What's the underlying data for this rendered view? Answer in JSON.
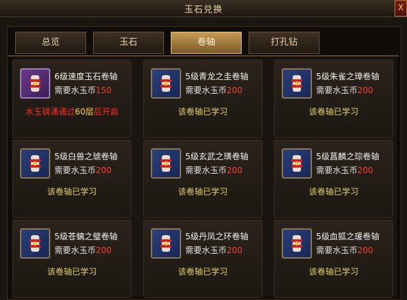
{
  "window": {
    "title": "玉石兑换",
    "close_label": "X"
  },
  "tabs": [
    "总览",
    "玉石",
    "卷轴",
    "打孔钻"
  ],
  "active_tab_index": 2,
  "currency": "需要水玉币",
  "scrolls": [
    {
      "name": "6级速度玉石卷轴",
      "cost": "150",
      "icon": "scroll-icon",
      "rarity": "purple",
      "status": "locked",
      "status_pre": "水玉镜涌通过",
      "status_mid": "60层",
      "status_post": "后开启"
    },
    {
      "name": "5级青龙之圭卷轴",
      "cost": "200",
      "icon": "scroll-icon",
      "rarity": "blue",
      "status": "learned",
      "status_text": "该卷轴已学习"
    },
    {
      "name": "5级朱雀之璋卷轴",
      "cost": "200",
      "icon": "scroll-icon",
      "rarity": "blue",
      "status": "learned",
      "status_text": "该卷轴已学习"
    },
    {
      "name": "5级白兽之琥卷轴",
      "cost": "200",
      "icon": "scroll-icon",
      "rarity": "blue",
      "status": "learned",
      "status_text": "该卷轴已学习"
    },
    {
      "name": "5级玄武之璜卷轴",
      "cost": "200",
      "icon": "scroll-icon",
      "rarity": "blue",
      "status": "learned",
      "status_text": "该卷轴已学习"
    },
    {
      "name": "5级菖麟之琮卷轴",
      "cost": "200",
      "icon": "scroll-icon",
      "rarity": "blue",
      "status": "learned",
      "status_text": "该卷轴已学习"
    },
    {
      "name": "5级苍螭之璧卷轴",
      "cost": "200",
      "icon": "scroll-icon",
      "rarity": "blue",
      "status": "learned",
      "status_text": "该卷轴已学习"
    },
    {
      "name": "5级丹凤之环卷轴",
      "cost": "200",
      "icon": "scroll-icon",
      "rarity": "blue",
      "status": "learned",
      "status_text": "该卷轴已学习"
    },
    {
      "name": "5级血狐之瑗卷轴",
      "cost": "200",
      "icon": "scroll-icon",
      "rarity": "blue",
      "status": "learned",
      "status_text": "该卷轴已学习"
    }
  ],
  "colors": {
    "cost": "#ff3d2e",
    "learned": "#e2d267",
    "locked": "#ff2b1f",
    "highlight": "#ffd84a"
  }
}
